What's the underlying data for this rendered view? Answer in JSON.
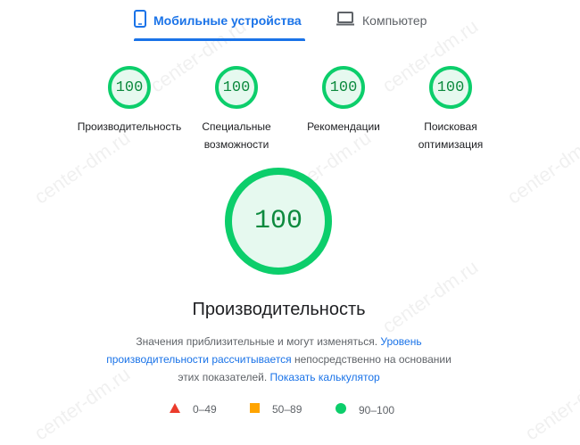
{
  "tabs": {
    "mobile": {
      "label": "Мобильные устройства",
      "icon": "smartphone-icon"
    },
    "desktop": {
      "label": "Компьютер",
      "icon": "laptop-icon"
    }
  },
  "categories": [
    {
      "score": "100",
      "label": "Производительность"
    },
    {
      "score": "100",
      "label": "Специальные возможности"
    },
    {
      "score": "100",
      "label": "Рекомендации"
    },
    {
      "score": "100",
      "label": "Поисковая оптимизация"
    }
  ],
  "main": {
    "score": "100",
    "title": "Производительность",
    "description": {
      "text1": "Значения приблизительные и могут изменяться. ",
      "link1": "Уровень производительности рассчитывается",
      "text2": " непосредственно на основании этих показателей. ",
      "link2": "Показать калькулятор"
    }
  },
  "legend": [
    {
      "range": "0–49",
      "color": "#eb3b2c",
      "shape": "triangle"
    },
    {
      "range": "50–89",
      "color": "#ffa400",
      "shape": "square"
    },
    {
      "range": "90–100",
      "color": "#0cce6b",
      "shape": "circle"
    }
  ],
  "watermark": "center-dm.ru",
  "colors": {
    "accent": "#1a73e8",
    "pass": "#0cce6b",
    "passFill": "#e6f9ef"
  }
}
